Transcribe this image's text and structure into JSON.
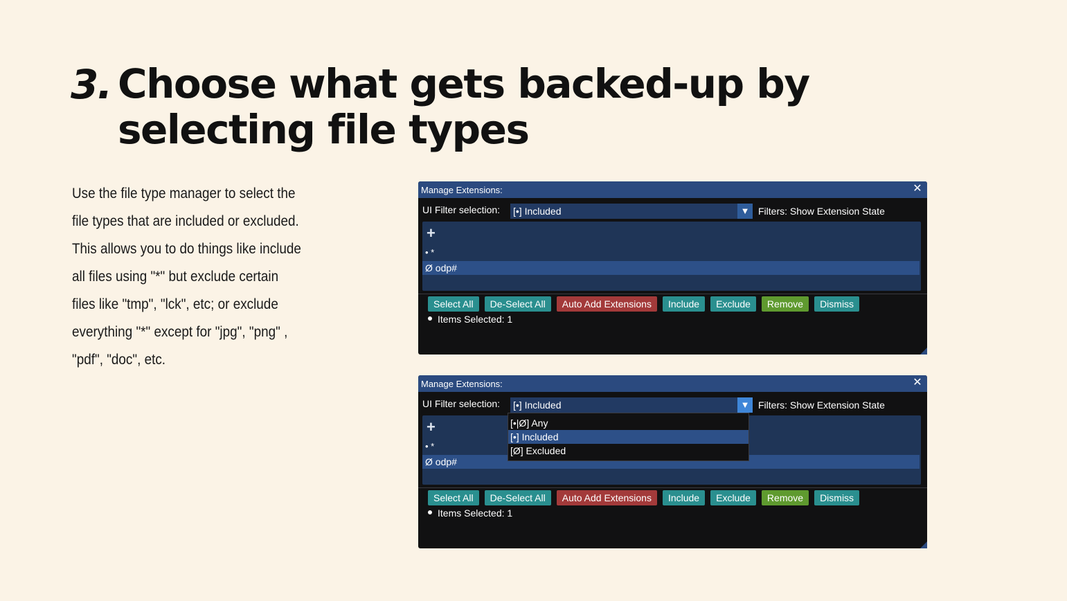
{
  "title": {
    "number": "3.",
    "line1": "Choose what gets backed-up by",
    "line2": "selecting file types"
  },
  "description": [
    "Use the file type manager to select the",
    "file types that are included or excluded.",
    "This allows you to do things like include",
    "all files using \"*\" but exclude certain",
    "files like \"tmp\", \"lck\", etc; or exclude",
    "everything \"*\" except for \"jpg\", \"png\" ,",
    "\"pdf\", \"doc\", etc."
  ],
  "window": {
    "title": "Manage Extensions:",
    "filter_label": "UI Filter selection:",
    "filter_value": "[•] Included",
    "filter_state": "Filters: Show Extension State",
    "items": {
      "all": "• *",
      "odp": "Ø odp#"
    },
    "buttons": {
      "select_all": "Select All",
      "deselect_all": "De-Select All",
      "auto_add": "Auto Add Extensions",
      "include": "Include",
      "exclude": "Exclude",
      "remove": "Remove",
      "dismiss": "Dismiss"
    },
    "status": "Items Selected: 1",
    "dropdown_options": [
      "[•|Ø] Any",
      "[•] Included",
      "[Ø] Excluded"
    ]
  },
  "colors": {
    "background": "#fbf3e6",
    "titlebar": "#2b4a7f",
    "teal_button": "#2a8f8f",
    "red_button": "#a33a3a",
    "green_button": "#5f9a2f"
  }
}
